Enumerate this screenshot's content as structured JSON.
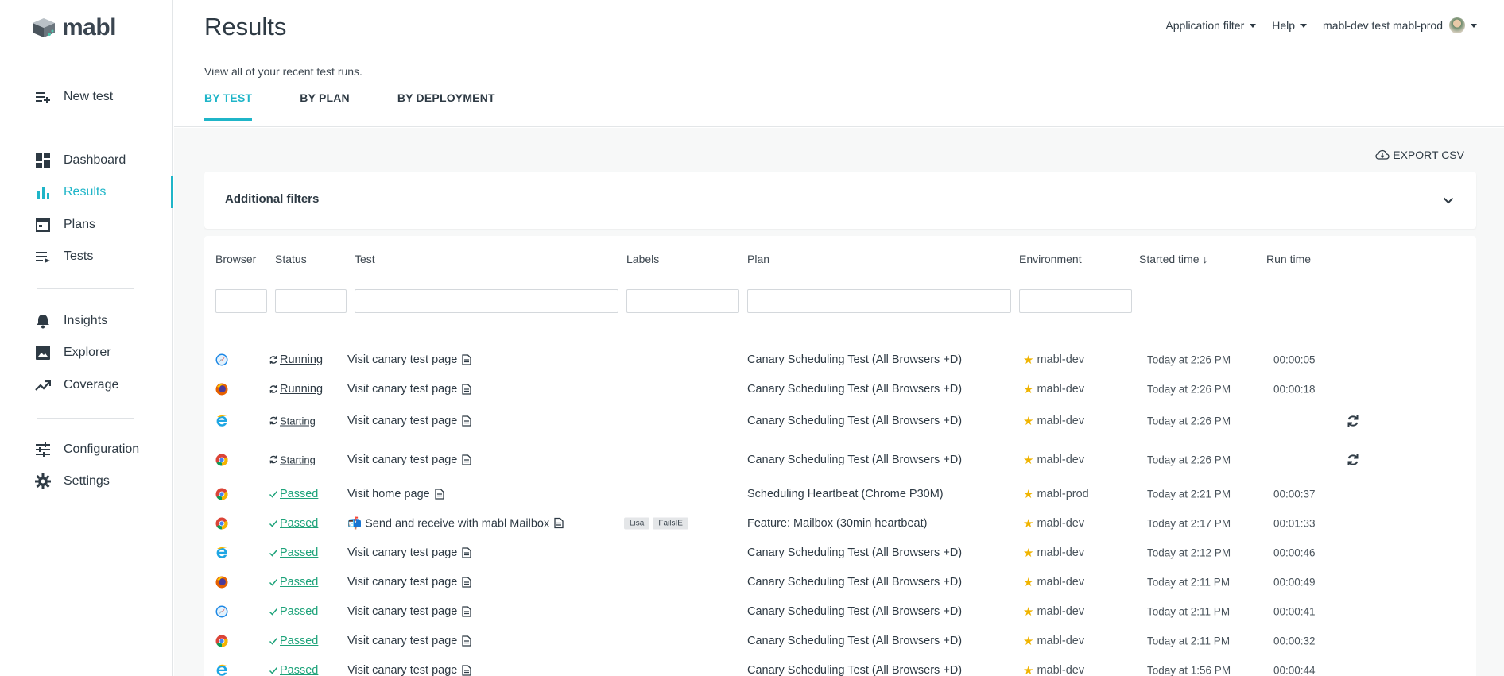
{
  "app": {
    "brand": "mabl"
  },
  "sidebar": {
    "items": [
      {
        "label": "New test",
        "icon": "new-test-icon"
      },
      {
        "label": "Dashboard",
        "icon": "dashboard-icon"
      },
      {
        "label": "Results",
        "icon": "results-icon",
        "active": true
      },
      {
        "label": "Plans",
        "icon": "plans-icon"
      },
      {
        "label": "Tests",
        "icon": "tests-icon"
      },
      {
        "label": "Insights",
        "icon": "bell-icon"
      },
      {
        "label": "Explorer",
        "icon": "image-icon"
      },
      {
        "label": "Coverage",
        "icon": "trend-icon"
      },
      {
        "label": "Configuration",
        "icon": "sliders-icon"
      },
      {
        "label": "Settings",
        "icon": "gear-icon"
      }
    ]
  },
  "header": {
    "title": "Results",
    "subtitle": "View all of your recent test runs.",
    "tabs": [
      "BY TEST",
      "BY PLAN",
      "BY DEPLOYMENT"
    ],
    "app_filter": "Application filter",
    "help": "Help",
    "workspace": "mabl-dev test mabl-prod"
  },
  "toolbar": {
    "export_label": "EXPORT CSV"
  },
  "filters": {
    "label": "Additional filters"
  },
  "table": {
    "columns": [
      "Browser",
      "Status",
      "Test",
      "Labels",
      "Plan",
      "Environment",
      "Started time ↓",
      "Run time"
    ],
    "rows": [
      {
        "browser": "safari",
        "status": "Running",
        "state": "running",
        "test": "Visit canary test page",
        "labels": [],
        "plan": "Canary Scheduling Test (All Browsers +D)",
        "env": "mabl-dev",
        "started": "Today at 2:26 PM",
        "runtime": "00:00:05",
        "refresh": false
      },
      {
        "browser": "firefox",
        "status": "Running",
        "state": "running",
        "test": "Visit canary test page",
        "labels": [],
        "plan": "Canary Scheduling Test (All Browsers +D)",
        "env": "mabl-dev",
        "started": "Today at 2:26 PM",
        "runtime": "00:00:18",
        "refresh": false
      },
      {
        "browser": "ie",
        "status": "Starting",
        "state": "starting",
        "test": "Visit canary test page",
        "labels": [],
        "plan": "Canary Scheduling Test (All Browsers +D)",
        "env": "mabl-dev",
        "started": "Today at 2:26 PM",
        "runtime": "",
        "refresh": true
      },
      {
        "browser": "chrome",
        "status": "Starting",
        "state": "starting",
        "test": "Visit canary test page",
        "labels": [],
        "plan": "Canary Scheduling Test (All Browsers +D)",
        "env": "mabl-dev",
        "started": "Today at 2:26 PM",
        "runtime": "",
        "refresh": true
      },
      {
        "browser": "chrome",
        "status": "Passed",
        "state": "passed",
        "test": "Visit home page",
        "labels": [],
        "plan": "Scheduling Heartbeat (Chrome P30M)",
        "env": "mabl-prod",
        "started": "Today at 2:21 PM",
        "runtime": "00:00:37",
        "refresh": false
      },
      {
        "browser": "chrome",
        "status": "Passed",
        "state": "passed",
        "test": "📬 Send and receive with mabl Mailbox",
        "labels": [
          "Lisa",
          "FailsIE"
        ],
        "plan": "Feature: Mailbox (30min heartbeat)",
        "env": "mabl-dev",
        "started": "Today at 2:17 PM",
        "runtime": "00:01:33",
        "refresh": false
      },
      {
        "browser": "ie",
        "status": "Passed",
        "state": "passed",
        "test": "Visit canary test page",
        "labels": [],
        "plan": "Canary Scheduling Test (All Browsers +D)",
        "env": "mabl-dev",
        "started": "Today at 2:12 PM",
        "runtime": "00:00:46",
        "refresh": false
      },
      {
        "browser": "firefox",
        "status": "Passed",
        "state": "passed",
        "test": "Visit canary test page",
        "labels": [],
        "plan": "Canary Scheduling Test (All Browsers +D)",
        "env": "mabl-dev",
        "started": "Today at 2:11 PM",
        "runtime": "00:00:49",
        "refresh": false
      },
      {
        "browser": "safari",
        "status": "Passed",
        "state": "passed",
        "test": "Visit canary test page",
        "labels": [],
        "plan": "Canary Scheduling Test (All Browsers +D)",
        "env": "mabl-dev",
        "started": "Today at 2:11 PM",
        "runtime": "00:00:41",
        "refresh": false
      },
      {
        "browser": "chrome",
        "status": "Passed",
        "state": "passed",
        "test": "Visit canary test page",
        "labels": [],
        "plan": "Canary Scheduling Test (All Browsers +D)",
        "env": "mabl-dev",
        "started": "Today at 2:11 PM",
        "runtime": "00:00:32",
        "refresh": false
      },
      {
        "browser": "ie",
        "status": "Passed",
        "state": "passed",
        "test": "Visit canary test page",
        "labels": [],
        "plan": "Canary Scheduling Test (All Browsers +D)",
        "env": "mabl-dev",
        "started": "Today at 1:56 PM",
        "runtime": "00:00:44",
        "refresh": false
      }
    ]
  },
  "colors": {
    "accent": "#1fb5c8",
    "passed": "#1ea37a",
    "star": "#f0b400"
  }
}
